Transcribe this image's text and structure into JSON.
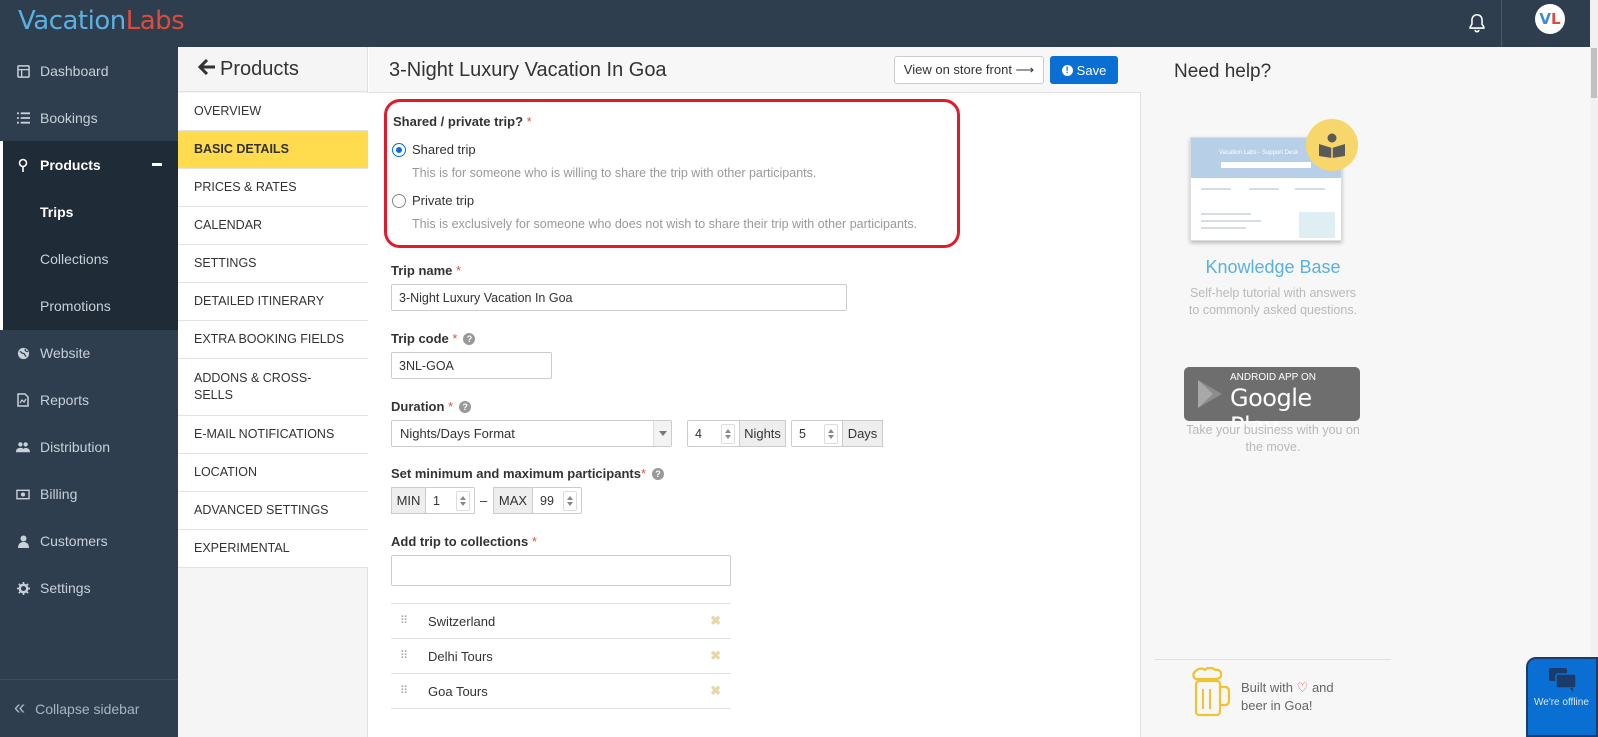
{
  "app": {
    "logo_part1": "Vacation",
    "logo_part2": "Labs",
    "avatar_part1": "V",
    "avatar_part2": "L"
  },
  "sidebar": {
    "items": [
      {
        "label": "Dashboard",
        "icon": "dashboard-icon"
      },
      {
        "label": "Bookings",
        "icon": "list-icon"
      },
      {
        "label": "Products",
        "icon": "pin-icon",
        "active": true
      },
      {
        "label": "Website",
        "icon": "globe-icon"
      },
      {
        "label": "Reports",
        "icon": "report-icon"
      },
      {
        "label": "Distribution",
        "icon": "users-icon"
      },
      {
        "label": "Billing",
        "icon": "money-icon"
      },
      {
        "label": "Customers",
        "icon": "user-icon"
      },
      {
        "label": "Settings",
        "icon": "gear-icon"
      }
    ],
    "subitems": [
      {
        "label": "Trips",
        "selected": true
      },
      {
        "label": "Collections"
      },
      {
        "label": "Promotions"
      }
    ],
    "collapse_label": "Collapse sidebar"
  },
  "product_nav": {
    "title": "Products",
    "items": [
      "OVERVIEW",
      "BASIC DETAILS",
      "PRICES & RATES",
      "CALENDAR",
      "SETTINGS",
      "DETAILED ITINERARY",
      "EXTRA BOOKING FIELDS",
      "ADDONS & CROSS-SELLS",
      "E-MAIL NOTIFICATIONS",
      "LOCATION",
      "ADVANCED SETTINGS",
      "EXPERIMENTAL"
    ],
    "active_index": 1
  },
  "header": {
    "title": "3-Night Luxury Vacation In Goa",
    "store_button": "View on store front ⟶",
    "save_button": "Save"
  },
  "form": {
    "trip_type": {
      "label": "Shared / private trip?",
      "required": "*",
      "options": [
        {
          "label": "Shared trip",
          "desc": "This is for someone who is willing to share the trip with other participants.",
          "selected": true
        },
        {
          "label": "Private trip",
          "desc": "This is exclusively for someone who does not wish to share their trip with other participants.",
          "selected": false
        }
      ]
    },
    "trip_name": {
      "label": "Trip name",
      "required": "*",
      "value": "3-Night Luxury Vacation In Goa"
    },
    "trip_code": {
      "label": "Trip code",
      "required": "*",
      "value": "3NL-GOA"
    },
    "duration": {
      "label": "Duration",
      "required": "*",
      "format": "Nights/Days Format",
      "nights_value": "4",
      "nights_label": "Nights",
      "days_value": "5",
      "days_label": "Days"
    },
    "participants": {
      "label": "Set minimum and maximum participants",
      "required": "*",
      "min_label": "MIN",
      "min_value": "1",
      "separator": "–",
      "max_label": "MAX",
      "max_value": "99"
    },
    "collections": {
      "label": "Add trip to collections",
      "required": "*",
      "input_value": "",
      "items": [
        "Switzerland",
        "Delhi Tours",
        "Goa Tours"
      ]
    }
  },
  "help": {
    "title": "Need help?",
    "kb_title": "Knowledge Base",
    "kb_desc_line1": "Self-help tutorial with answers",
    "kb_desc_line2": "to commonly asked questions.",
    "kb_thumb_title": "Vacation Labs - Support Desk",
    "gp_small": "ANDROID APP ON",
    "gp_big": "Google Play",
    "gp_desc_line1": "Take your business with you on",
    "gp_desc_line2": "the move.",
    "built_line1_a": "Built with",
    "built_line1_b": "and",
    "built_line2": "beer in Goa!"
  },
  "chat": {
    "status": "We're offline"
  },
  "colors": {
    "topbar": "#2e3e4e",
    "accent": "#0a6fd3",
    "active_tab": "#ffdb4d",
    "highlight": "#e21b2a"
  }
}
